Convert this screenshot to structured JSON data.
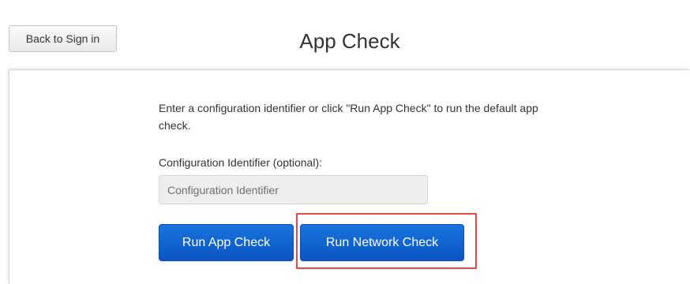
{
  "header": {
    "back_label": "Back to Sign in",
    "title": "App Check"
  },
  "main": {
    "instructions": "Enter a configuration identifier or click \"Run App Check\" to run the default app check.",
    "field_label": "Configuration Identifier (optional):",
    "config_input": {
      "value": "",
      "placeholder": "Configuration Identifier"
    },
    "run_app_check_label": "Run App Check",
    "run_network_check_label": "Run Network Check"
  },
  "colors": {
    "primary_button": "#0b62d6",
    "highlight": "#e24a4a",
    "input_background": "#eeeeee"
  }
}
